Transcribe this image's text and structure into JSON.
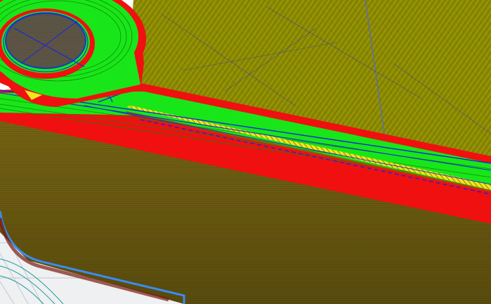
{
  "viewer": {
    "kind": "g-code layer preview",
    "colors": {
      "background": "#ffffff",
      "bed": "#eef0f2",
      "bed_grid": "#c3cad2",
      "bed_edge": "#3a8cf0",
      "infill": "#8c8a00",
      "outer_wall": "#f01010",
      "inner_wall": "#19e619",
      "travel": "#1428dc",
      "top_solid": "#f0e61a",
      "wall_shadow": "#7a1a10"
    },
    "legend_icons": [
      "outer-wall-path-icon",
      "inner-wall-path-icon",
      "infill-path-icon",
      "travel-move-icon",
      "top-solid-fill-icon"
    ]
  }
}
